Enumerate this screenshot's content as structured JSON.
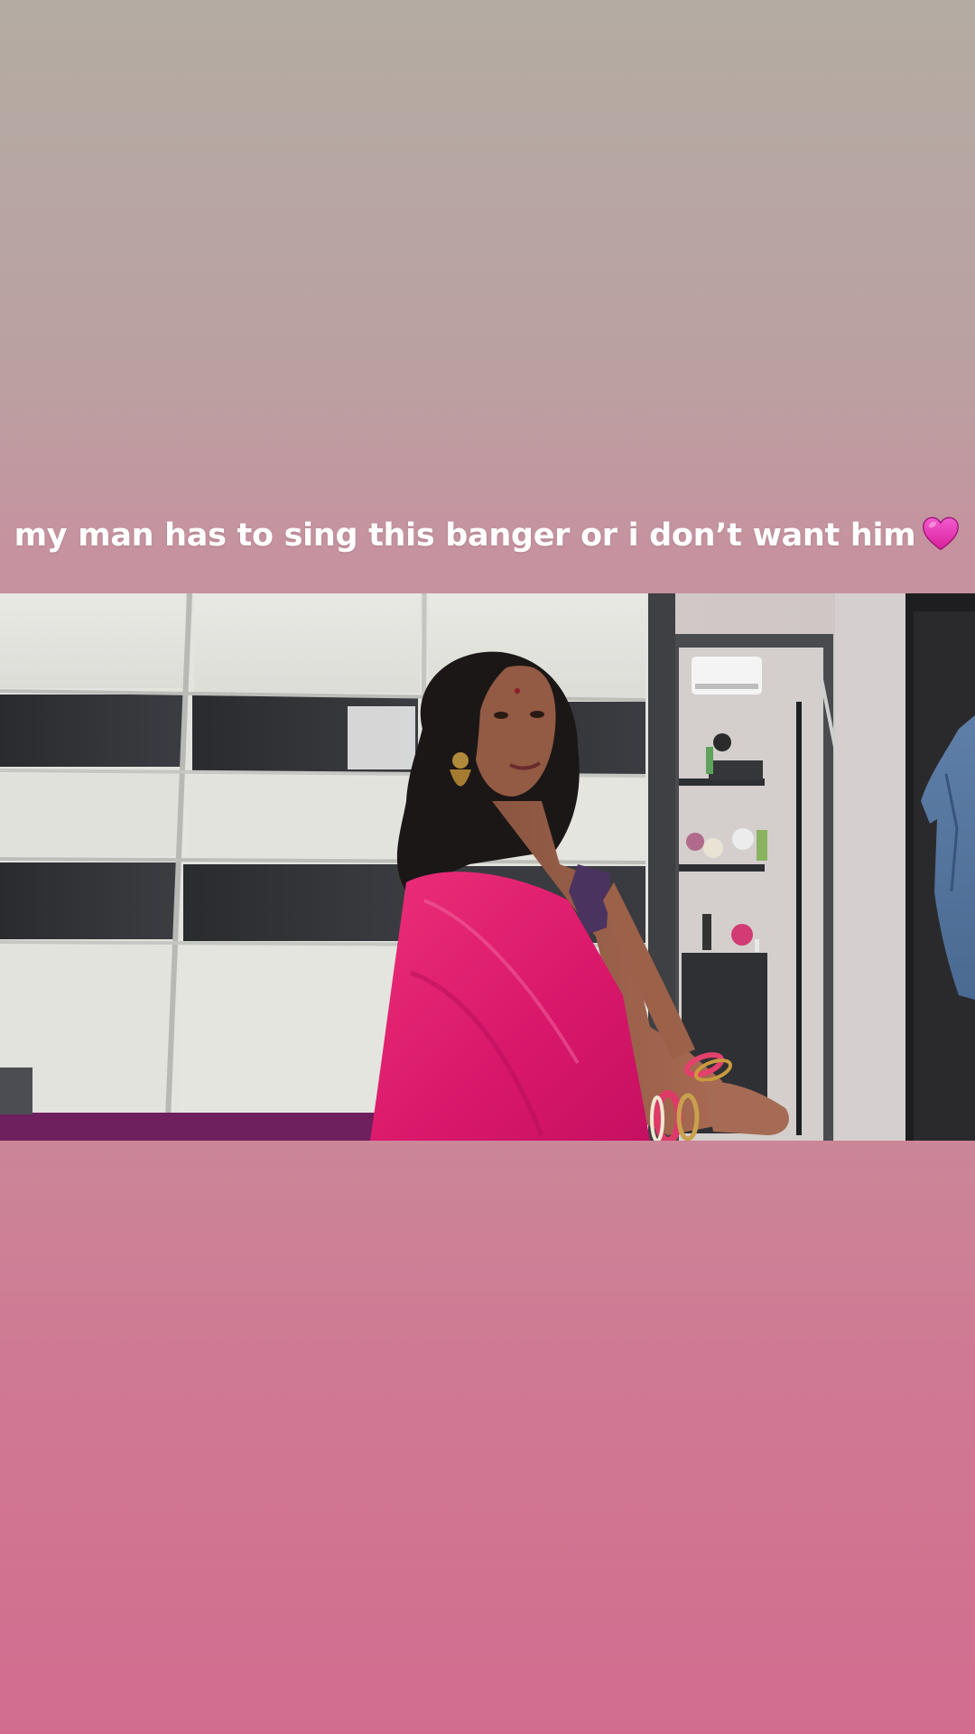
{
  "story": {
    "caption": "my man has to sing this banger or i don’t want him",
    "caption_emoji": "pink-heart-icon",
    "colors": {
      "top": "#b4aca3",
      "middle": "#c7909b",
      "bottom": "#d26d8f",
      "heart": "#e02ea8",
      "saree": "#e0206e"
    }
  }
}
